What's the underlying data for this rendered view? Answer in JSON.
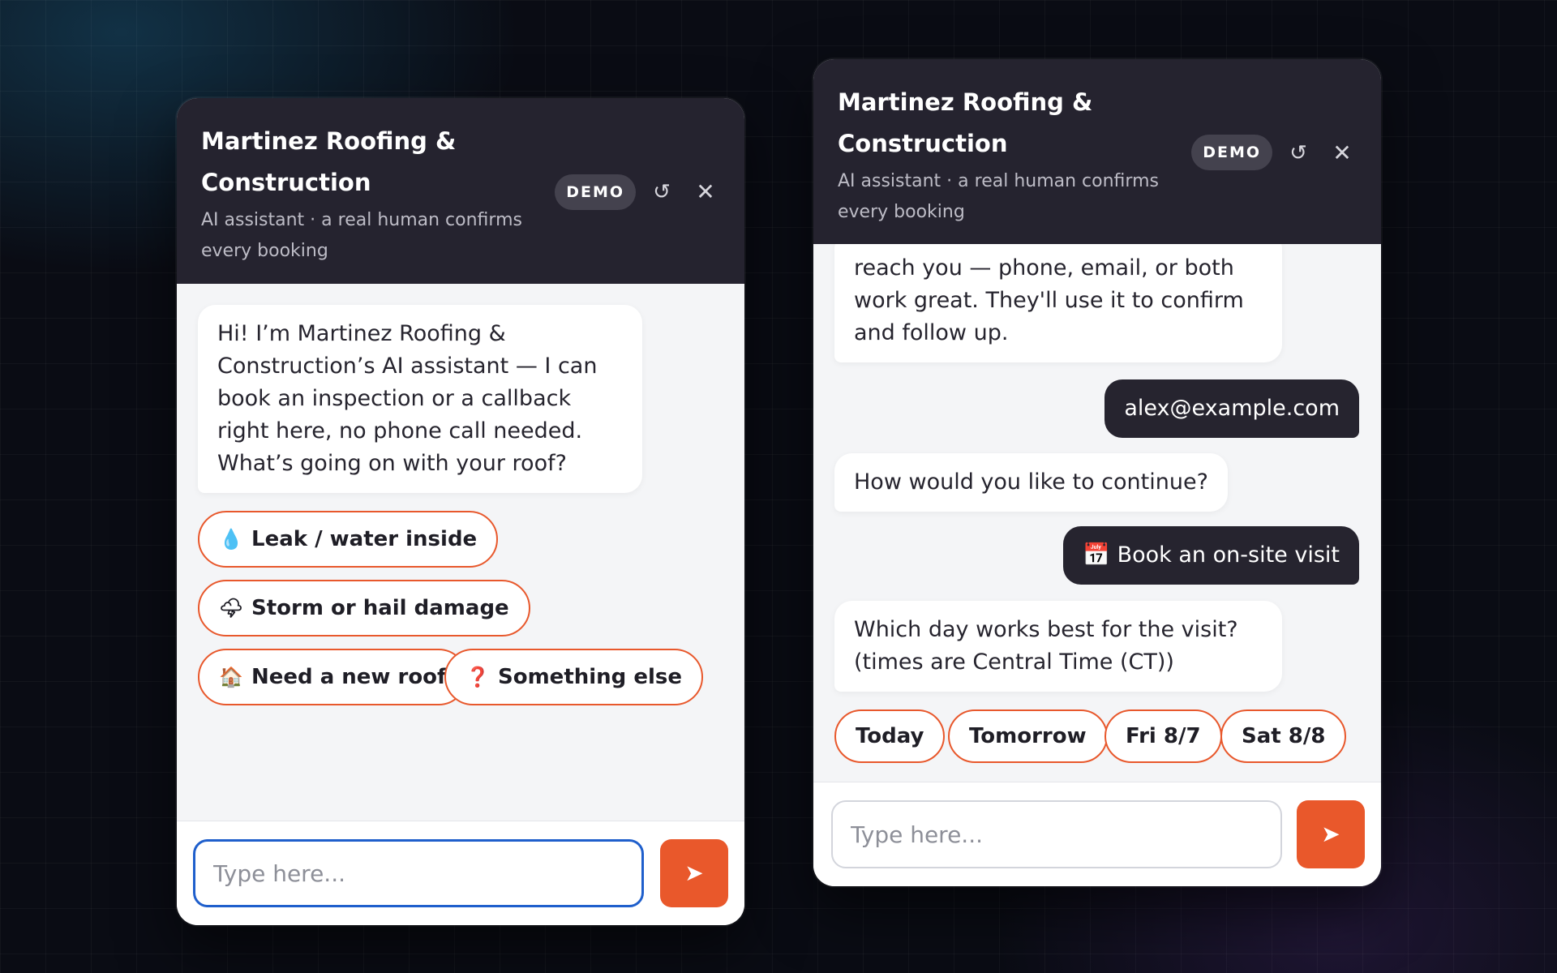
{
  "widget_left": {
    "header": {
      "title": "Martinez Roofing & Construction",
      "subtitle": "AI assistant · a real human confirms every booking",
      "badge": "DEMO",
      "reset_glyph": "↺",
      "close_glyph": "✕"
    },
    "messages": [
      {
        "role": "bot",
        "text": "Hi! I’m Martinez Roofing & Construction’s AI assistant — I can book an inspection or a callback right here, no phone call needed. What’s going on with your roof?"
      }
    ],
    "chips": [
      {
        "emoji": "💧",
        "label": "Leak / water inside"
      },
      {
        "emoji": "🌩",
        "label": "Storm or hail damage"
      },
      {
        "emoji": "🏠",
        "label": "Need a new roof"
      },
      {
        "emoji": "❓",
        "label": "Something else"
      }
    ],
    "input": {
      "placeholder": "Type here...",
      "value": ""
    },
    "send_glyph": "➤"
  },
  "widget_right": {
    "header": {
      "title": "Martinez Roofing & Construction",
      "subtitle": "AI assistant · a real human confirms every booking",
      "badge": "DEMO",
      "reset_glyph": "↺",
      "close_glyph": "✕"
    },
    "messages": [
      {
        "role": "bot",
        "text": "reach you — phone, email, or both work great. They'll use it to confirm and follow up."
      },
      {
        "role": "user",
        "text": "alex@example.com"
      },
      {
        "role": "bot",
        "text": "How would you like to continue?"
      },
      {
        "role": "user",
        "emoji": "📅",
        "text": "Book an on-site visit"
      },
      {
        "role": "bot",
        "text": "Which day works best for the visit? (times are Central Time (CT))"
      }
    ],
    "day_chips": [
      "Today",
      "Tomorrow",
      "Fri 8/7",
      "Sat 8/8"
    ],
    "input": {
      "placeholder": "Type here...",
      "value": ""
    },
    "send_glyph": "➤"
  },
  "colors": {
    "accent": "#e9582b",
    "header_bg": "#25232f",
    "user_bubble": "#26242f",
    "focus_ring": "#1f5fcc"
  }
}
